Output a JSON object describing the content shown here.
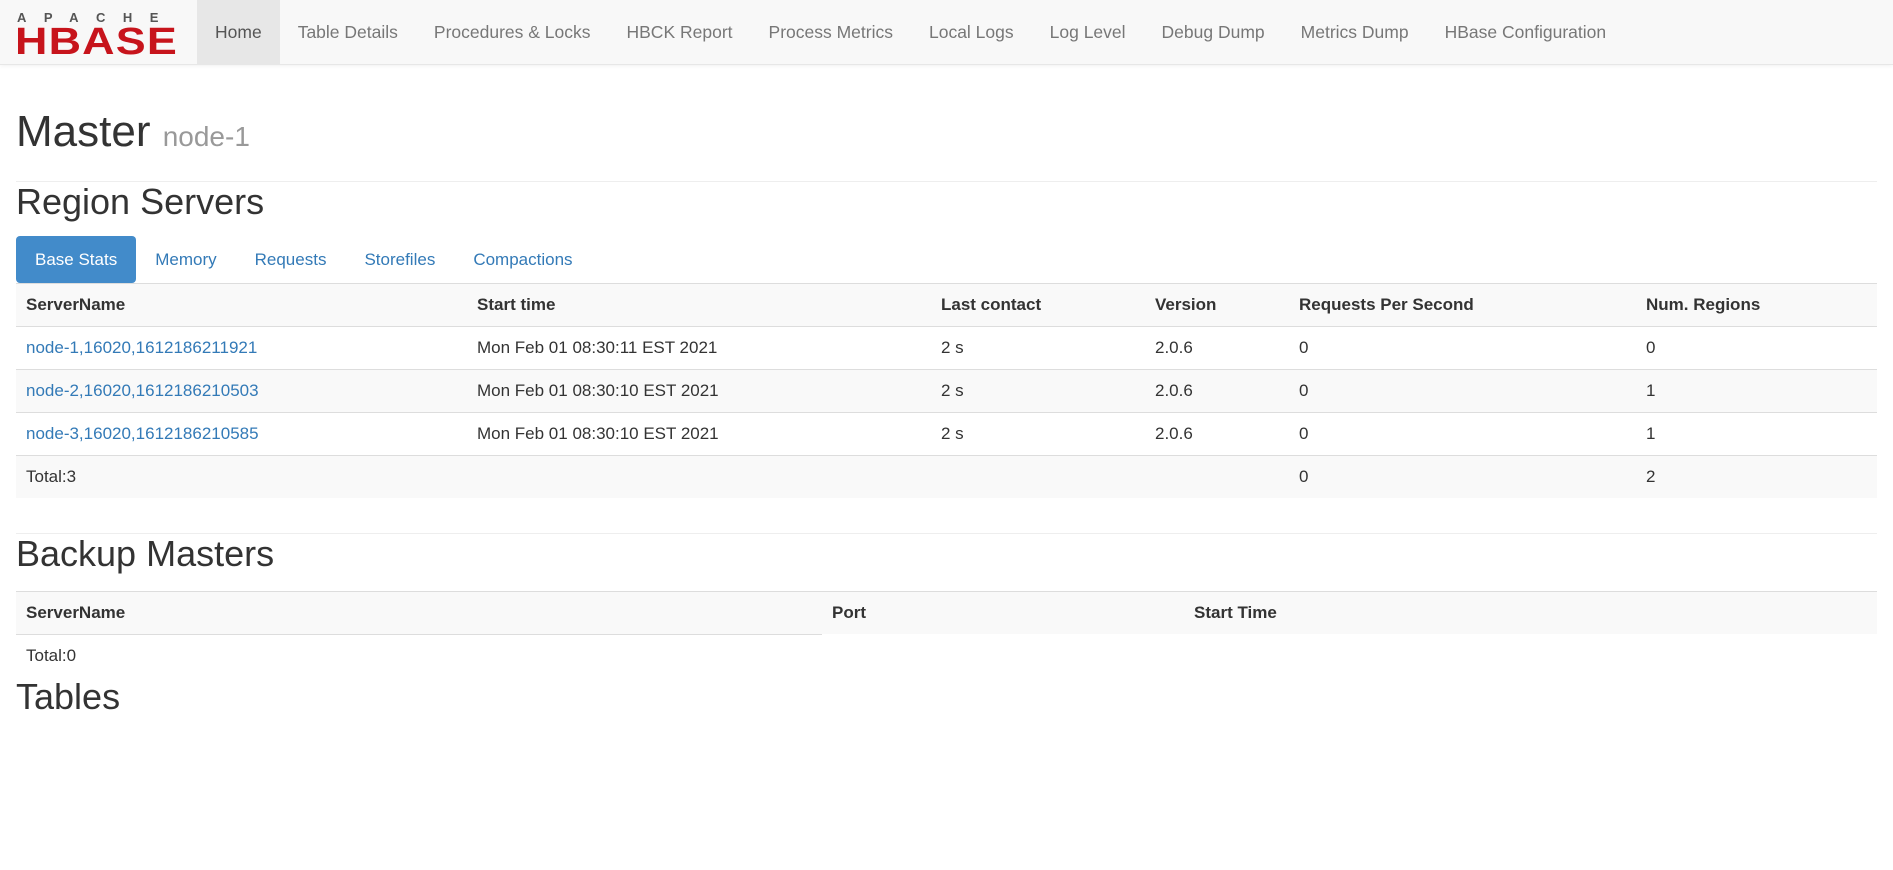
{
  "logo": {
    "top_text": "APACHE",
    "main_text": "HBASE",
    "color": "#c7141c"
  },
  "nav": {
    "items": [
      {
        "label": "Home",
        "active": true
      },
      {
        "label": "Table Details"
      },
      {
        "label": "Procedures & Locks"
      },
      {
        "label": "HBCK Report"
      },
      {
        "label": "Process Metrics"
      },
      {
        "label": "Local Logs"
      },
      {
        "label": "Log Level"
      },
      {
        "label": "Debug Dump"
      },
      {
        "label": "Metrics Dump"
      },
      {
        "label": "HBase Configuration"
      }
    ]
  },
  "header": {
    "title": "Master",
    "subtitle": "node-1"
  },
  "region_servers": {
    "title": "Region Servers",
    "tabs": [
      {
        "label": "Base Stats",
        "active": true
      },
      {
        "label": "Memory"
      },
      {
        "label": "Requests"
      },
      {
        "label": "Storefiles"
      },
      {
        "label": "Compactions"
      }
    ],
    "columns": [
      "ServerName",
      "Start time",
      "Last contact",
      "Version",
      "Requests Per Second",
      "Num. Regions"
    ],
    "rows": [
      [
        "node-1,16020,1612186211921",
        "Mon Feb 01 08:30:11 EST 2021",
        "2 s",
        "2.0.6",
        "0",
        "0"
      ],
      [
        "node-2,16020,1612186210503",
        "Mon Feb 01 08:30:10 EST 2021",
        "2 s",
        "2.0.6",
        "0",
        "1"
      ],
      [
        "node-3,16020,1612186210585",
        "Mon Feb 01 08:30:10 EST 2021",
        "2 s",
        "2.0.6",
        "0",
        "1"
      ]
    ],
    "total": [
      "Total:3",
      "",
      "",
      "",
      "0",
      "2"
    ]
  },
  "backup_masters": {
    "title": "Backup Masters",
    "columns": [
      "ServerName",
      "Port",
      "Start Time"
    ],
    "total": "Total:0"
  },
  "tables": {
    "title": "Tables"
  },
  "colors": {
    "link": "#337ab7",
    "active_tab": "#428bca"
  }
}
